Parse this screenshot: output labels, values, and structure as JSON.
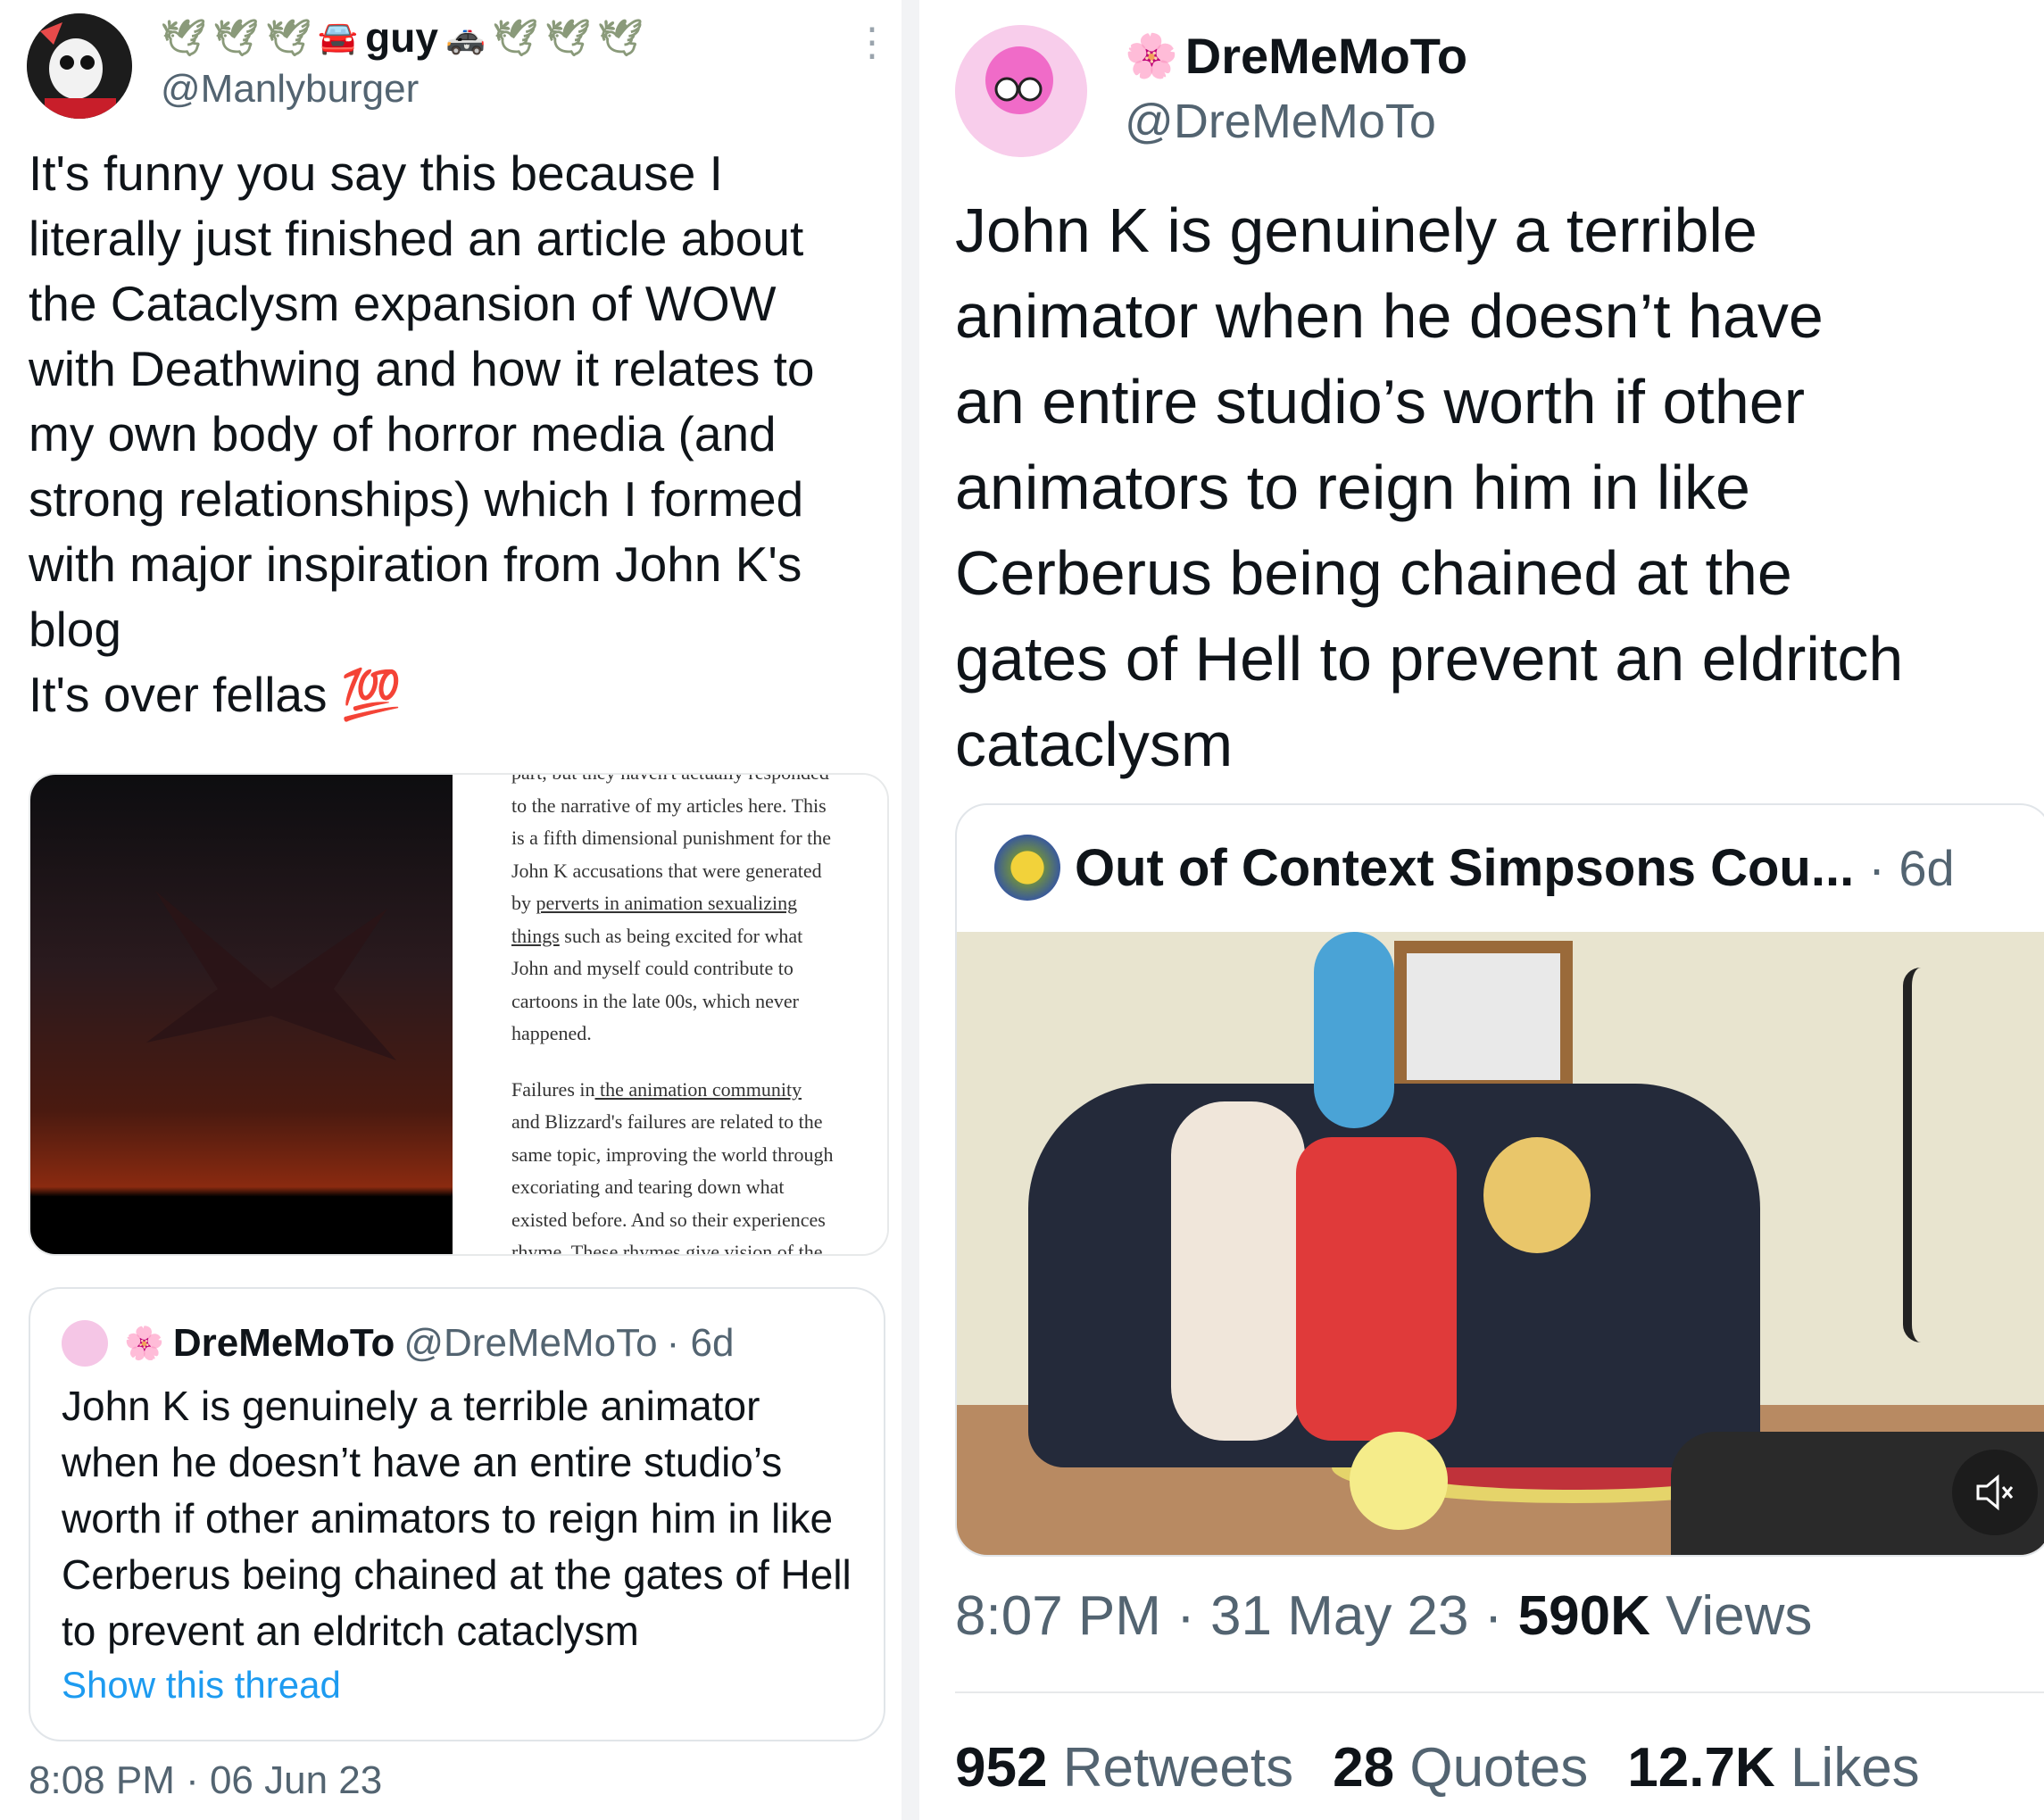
{
  "left_tweet": {
    "display_name": "guy",
    "handle": "@Manlyburger",
    "text": "It's funny you say this because I\nliterally just finished an article about\nthe Cataclysm expansion of WOW\nwith Deathwing and how it relates to\nmy own body of horror media (and\nstrong relationships) which I formed\nwith major inspiration from John K's\nblog\nIt's over fellas 💯",
    "image_doc_text": {
      "line0": "part, but they haven't actually responded",
      "line1": "to the narrative of my articles here. This",
      "line2": "is a fifth dimensional punishment for the",
      "line3": "John K accusations that were generated",
      "line4_pre": "by ",
      "line4_link": "perverts in animation sexualizing",
      "line5_link": "things",
      "line5_post": " such as being excited for what",
      "line6": "John and myself could contribute to",
      "line7": "cartoons in the late 00s, which never",
      "line8": "happened.",
      "line9_pre": "Failures in",
      "line9_link": " the animation community",
      "line10": "and Blizzard's failures are related to the",
      "line11": "same topic, improving the world through",
      "line12": "excoriating and tearing down what",
      "line13": "existed before. And so their experiences",
      "line14": "rhyme. These rhymes give vision of the"
    },
    "quoted": {
      "name": "DreMeMoTo",
      "handle": "@DreMeMoTo",
      "age": "· 6d",
      "text": "John K is genuinely a terrible animator when he doesn’t have an entire studio’s worth if other animators to reign him in like Cerberus being chained at the gates of Hell to prevent an eldritch cataclysm",
      "link": "Show this thread"
    },
    "timestamp": "8:08 PM · 06 Jun 23"
  },
  "right_tweet": {
    "display_name": "DreMeMoTo",
    "handle": "@DreMeMoTo",
    "text": "John K is genuinely a terrible\nanimator when he doesn’t have\nan entire studio’s worth if other\nanimators to reign him in like\nCerberus being chained at the\ngates of Hell to prevent an eldritch\ncataclysm",
    "embed": {
      "account": "Out of Context Simpsons Cou...",
      "age": "· 6d"
    },
    "time": "8:07 PM",
    "date": "31 May 23",
    "views_count": "590K",
    "views_label": "Views",
    "retweets_count": "952",
    "retweets_label": "Retweets",
    "quotes_count": "28",
    "quotes_label": "Quotes",
    "likes_count": "12.7K",
    "likes_label": "Likes"
  },
  "icons": {
    "dove": "🕊",
    "car": "🚘",
    "police_car": "🚓",
    "flower": "🌸",
    "more": "⋮",
    "mute": "🔇"
  }
}
